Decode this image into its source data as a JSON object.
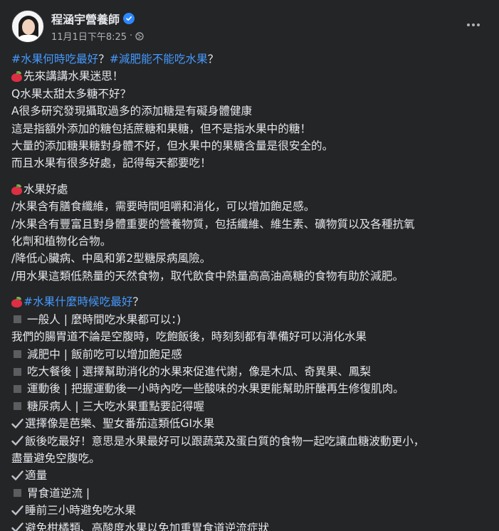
{
  "post": {
    "author": "程涵宇營養師",
    "timestamp": "11月1日下午8:25",
    "separator": "·",
    "colors": {
      "background": "#242526",
      "text": "#e4e6eb",
      "hashtag": "#4599ff",
      "secondary": "#b0b3b8",
      "verified": "#2d88ff"
    },
    "icons": {
      "verified": "verified-badge-icon",
      "privacy": "globe-icon",
      "more": "more-options-icon",
      "apple": "red-apple-emoji",
      "square": "small-square-emoji",
      "check": "check-mark-emoji"
    }
  },
  "content": {
    "l1_tag1": "#水果何時吃最好",
    "l1_q": "？",
    "l1_tag2": "#減肥能不能吃水果",
    "l1_q2": "？",
    "l2": "先來講講水果迷思！",
    "l3": "Q水果太甜太多糖不好？",
    "l4": "A很多研究發現攝取過多的添加糖是有礙身體健康",
    "l5": "這是指額外添加的糖包括蔗糖和果糖，但不是指水果中的糖！",
    "l6": "大量的添加糖果糖對身體不好，但水果中的果糖含量是很安全的。",
    "l7": "而且水果有很多好處，記得每天都要吃！",
    "l8": "水果好處",
    "l9": "/水果含有膳食纖維，需要時間咀嚼和消化，可以增加飽足感。",
    "l10a": "/水果含有豐富且對身體重要的營養物質，包括纖維、維生素、礦物質以及各種抗氧",
    "l10b": "化劑和植物化合物。",
    "l11": "/降低心臟病、中風和第2型糖尿病風險。",
    "l12": "/用水果這類低熱量的天然食物，取代飲食中熱量高高油高糖的食物有助於減肥。",
    "l13_tag": "#水果什麼時候吃最好",
    "l13_q": "？",
    "l14": "一般人 | 麼時間吃水果都可以：)",
    "l15": "我們的腸胃道不論是空腹時，吃飽飯後，時刻刻都有準備好可以消化水果",
    "l16": "減肥中 | 飯前吃可以增加飽足感",
    "l17": "吃大餐後 | 選擇幫助消化的水果來促進代謝，像是木瓜、奇異果、鳳梨",
    "l18": "運動後 | 把握運動後一小時內吃一些酸味的水果更能幫助肝醣再生修復肌肉。",
    "l19": "糖尿病人 | 三大吃水果重點要記得喔",
    "l20": "選擇像是芭樂、聖女番茄這類低GI水果",
    "l21a": "飯後吃最好！意思是水果最好可以跟蔬菜及蛋白質的食物一起吃讓血糖波動更小，",
    "l21b": "盡量避免空腹吃。",
    "l22": "適量",
    "l23": "胃食道逆流 |",
    "l24": "睡前三小時避免吃水果",
    "l25": "避免柑橘類、高酸度水果以免加重胃食道逆流症狀"
  }
}
